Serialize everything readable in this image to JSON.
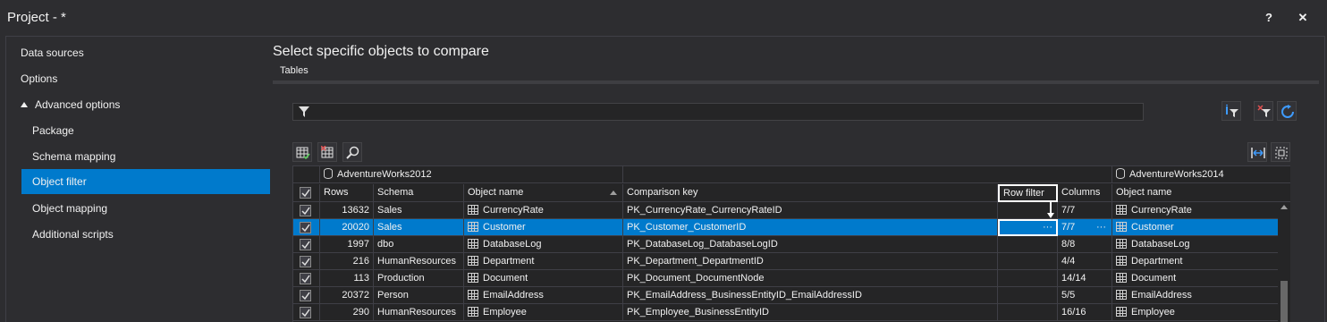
{
  "window": {
    "title": "Project - *",
    "help_label": "?",
    "close_label": "✕"
  },
  "nav": {
    "items": [
      {
        "label": "Data sources"
      },
      {
        "label": "Options"
      },
      {
        "label": "Advanced options"
      },
      {
        "label": "Package"
      },
      {
        "label": "Schema mapping"
      },
      {
        "label": "Object filter"
      },
      {
        "label": "Object mapping"
      },
      {
        "label": "Additional scripts"
      }
    ],
    "active": "Object filter"
  },
  "main": {
    "heading": "Select specific objects to compare",
    "tab": "Tables",
    "filter_placeholder": ""
  },
  "grid": {
    "left_db": "AdventureWorks2012",
    "right_db": "AdventureWorks2014",
    "headers": {
      "rows": "Rows",
      "schema": "Schema",
      "object_name": "Object name",
      "comparison_key": "Comparison key",
      "row_filter": "Row filter",
      "columns": "Columns",
      "object_name_right": "Object name"
    },
    "rows": [
      {
        "rows": "13632",
        "schema": "Sales",
        "name": "CurrencyRate",
        "key": "PK_CurrencyRate_CurrencyRateID",
        "filter": "",
        "columns": "7/7",
        "right_name": "CurrencyRate"
      },
      {
        "rows": "20020",
        "schema": "Sales",
        "name": "Customer",
        "key": "PK_Customer_CustomerID",
        "filter": "···",
        "columns": "7/7",
        "right_name": "Customer",
        "cols_btn": "···"
      },
      {
        "rows": "1997",
        "schema": "dbo",
        "name": "DatabaseLog",
        "key": "PK_DatabaseLog_DatabaseLogID",
        "filter": "",
        "columns": "8/8",
        "right_name": "DatabaseLog"
      },
      {
        "rows": "216",
        "schema": "HumanResources",
        "name": "Department",
        "key": "PK_Department_DepartmentID",
        "filter": "",
        "columns": "4/4",
        "right_name": "Department"
      },
      {
        "rows": "113",
        "schema": "Production",
        "name": "Document",
        "key": "PK_Document_DocumentNode",
        "filter": "",
        "columns": "14/14",
        "right_name": "Document"
      },
      {
        "rows": "20372",
        "schema": "Person",
        "name": "EmailAddress",
        "key": "PK_EmailAddress_BusinessEntityID_EmailAddressID",
        "filter": "",
        "columns": "5/5",
        "right_name": "EmailAddress"
      },
      {
        "rows": "290",
        "schema": "HumanResources",
        "name": "Employee",
        "key": "PK_Employee_BusinessEntityID",
        "filter": "",
        "columns": "16/16",
        "right_name": "Employee"
      }
    ]
  },
  "colors": {
    "accent": "#007acc",
    "background": "#2d2d30",
    "grid_bg": "#252526"
  }
}
